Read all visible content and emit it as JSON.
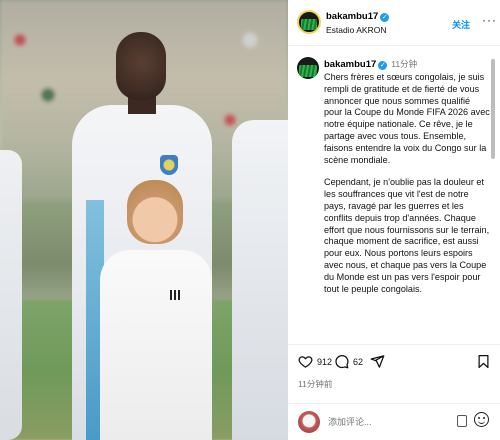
{
  "header": {
    "username": "bakambu17",
    "location": "Estadio AKRON",
    "follow_label": "关注",
    "more": "···"
  },
  "post": {
    "username": "bakambu17",
    "time": "11分钟",
    "caption_p1": "Chers frères et sœurs congolais, je suis rempli de gratitude et de fierté de vous annoncer que nous sommes qualifié pour la Coupe du Monde FIFA 2026 avec notre équipe nationale. Ce rêve, je le partage avec vous tous. Ensemble, faisons entendre la voix du Congo sur la scène mondiale.",
    "caption_p2": "Cependant, je n'oublie pas la douleur et les souffrances que vit l'est de notre pays, ravagé par les guerres et les conflits depuis trop d'années. Chaque effort que nous fournissons sur le terrain, chaque moment de sacrifice, est aussi pour eux. Nous portons leurs espoirs avec nous, et chaque pas vers la Coupe du Monde est un pas vers l'espoir pour tout le peuple congolais."
  },
  "actions": {
    "likes": "912",
    "comments": "62",
    "time_ago": "11分钟前"
  },
  "comment_box": {
    "placeholder": "添加评论..."
  },
  "icons": [
    "heart-icon",
    "comment-icon",
    "share-icon",
    "bookmark-icon",
    "gif-icon",
    "emoji-icon",
    "verified-icon"
  ],
  "colors": {
    "follow": "#0095f6",
    "verified": "#1d9bf0"
  }
}
